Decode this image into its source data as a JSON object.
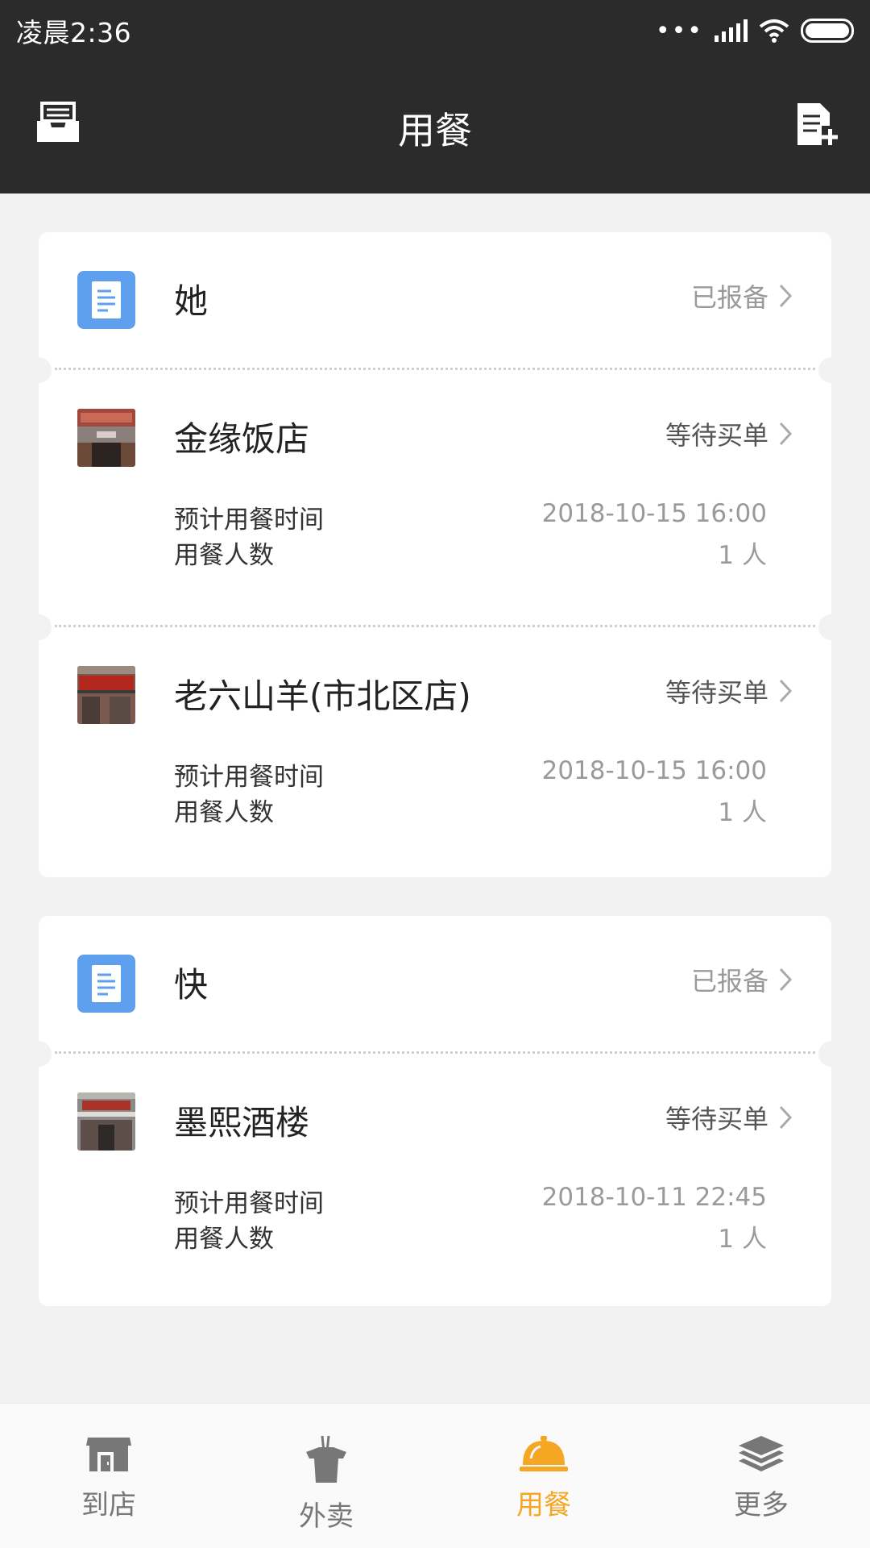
{
  "status_bar": {
    "time": "凌晨2:36"
  },
  "header": {
    "title": "用餐",
    "left_icon": "inbox-tray-icon",
    "right_icon": "document-add-icon"
  },
  "colors": {
    "header_bg": "#2b2b2b",
    "accent": "#f5a623",
    "doc_icon_bg": "#5ea0ee",
    "page_bg": "#f2f2f2"
  },
  "groups": [
    {
      "name": "她",
      "status": "已报备",
      "orders": [
        {
          "shop": "金缘饭店",
          "status": "等待买单",
          "time_label": "预计用餐时间",
          "time": "2018-10-15 16:00",
          "people_label": "用餐人数",
          "people": "1 人"
        },
        {
          "shop": "老六山羊(市北区店)",
          "status": "等待买单",
          "time_label": "预计用餐时间",
          "time": "2018-10-15 16:00",
          "people_label": "用餐人数",
          "people": "1 人"
        }
      ]
    },
    {
      "name": "快",
      "status": "已报备",
      "orders": [
        {
          "shop": "墨熙酒楼",
          "status": "等待买单",
          "time_label": "预计用餐时间",
          "time": "2018-10-11 22:45",
          "people_label": "用餐人数",
          "people": "1 人"
        }
      ]
    }
  ],
  "nav": [
    {
      "label": "到店",
      "icon": "store-icon",
      "active": false
    },
    {
      "label": "外卖",
      "icon": "takeout-box-icon",
      "active": false
    },
    {
      "label": "用餐",
      "icon": "dining-cloche-icon",
      "active": true
    },
    {
      "label": "更多",
      "icon": "layers-icon",
      "active": false
    }
  ]
}
